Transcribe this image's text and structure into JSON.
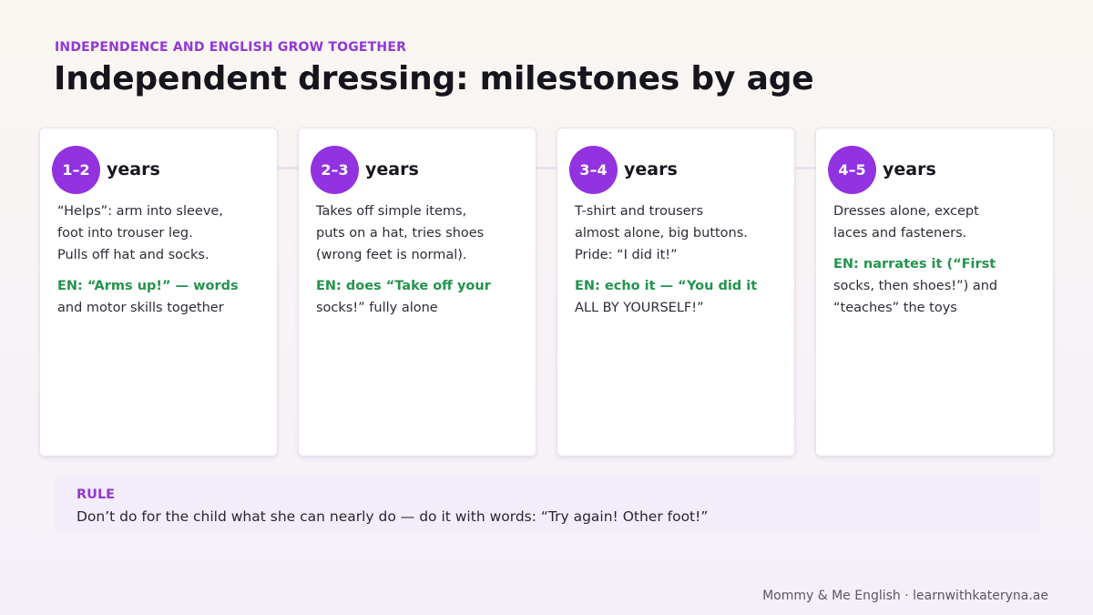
{
  "header": {
    "kicker": "INDEPENDENCE AND ENGLISH GROW TOGETHER",
    "title": "Independent dressing: milestones by age"
  },
  "cards": [
    {
      "age": "1–2",
      "unit": "years",
      "description": "“Helps”: arm into sleeve,\nfoot into trouser leg.\nPulls off hat and socks.",
      "en_strong": "EN: “Arms up!” — words",
      "en_rest": "\nand motor skills together"
    },
    {
      "age": "2–3",
      "unit": "years",
      "description": "Takes off simple items,\nputs on a hat, tries shoes\n(wrong feet is normal).",
      "en_strong": "EN: does “Take off your",
      "en_rest": "\nsocks!” fully alone"
    },
    {
      "age": "3–4",
      "unit": "years",
      "description": "T-shirt and trousers\nalmost alone, big buttons.\nPride: “I did it!”",
      "en_strong": "EN: echo it — “You did it",
      "en_rest": "\nALL BY YOURSELF!”"
    },
    {
      "age": "4–5",
      "unit": "years",
      "description": "Dresses alone, except\nlaces and fasteners.",
      "en_strong": "EN: narrates it (“First",
      "en_rest": "\nsocks, then shoes!”) and\n“teaches” the toys"
    }
  ],
  "rule": {
    "label": "RULE",
    "text": "Don’t do for the child what she can nearly do — do it with words: “Try again! Other foot!”"
  },
  "footer": {
    "credit": "Mommy & Me English · learnwithkateryna.ae"
  },
  "colors": {
    "accent_purple": "#9232e0",
    "en_green": "#23944d"
  }
}
